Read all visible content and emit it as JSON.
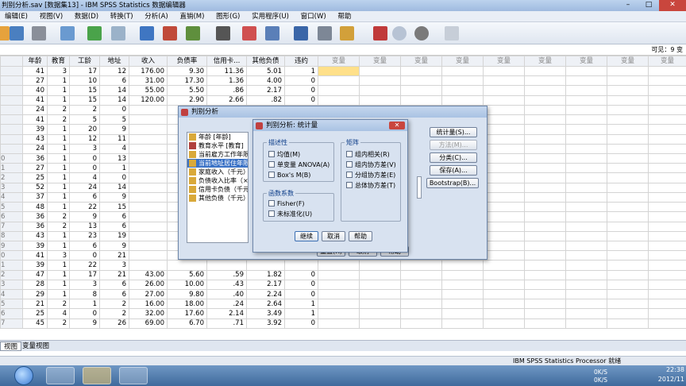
{
  "window": {
    "title": "判别分析.sav [数据集13] - IBM SPSS Statistics 数据编辑器",
    "controls": {
      "minimize": "–",
      "maximize": "□",
      "close": "✕"
    }
  },
  "menu": [
    "编辑(E)",
    "视图(V)",
    "数据(D)",
    "转换(T)",
    "分析(A)",
    "直销(M)",
    "图形(G)",
    "实用程序(U)",
    "窗口(W)",
    "帮助"
  ],
  "visible_vars": "可见：9 变",
  "grid": {
    "columns": [
      "年龄",
      "教育",
      "工龄",
      "地址",
      "收入",
      "负债率",
      "信用卡...",
      "其他负债",
      "违约",
      "变量",
      "变量",
      "变量",
      "变量",
      "变量",
      "变量",
      "变量",
      "变量",
      "变量"
    ],
    "rows": [
      {
        "n": "",
        "cells": [
          "41",
          "3",
          "17",
          "12",
          "176.00",
          "9.30",
          "11.36",
          "5.01",
          "1"
        ]
      },
      {
        "n": "",
        "cells": [
          "27",
          "1",
          "10",
          "6",
          "31.00",
          "17.30",
          "1.36",
          "4.00",
          "0"
        ]
      },
      {
        "n": "",
        "cells": [
          "40",
          "1",
          "15",
          "14",
          "55.00",
          "5.50",
          ".86",
          "2.17",
          "0"
        ]
      },
      {
        "n": "",
        "cells": [
          "41",
          "1",
          "15",
          "14",
          "120.00",
          "2.90",
          "2.66",
          ".82",
          "0"
        ]
      },
      {
        "n": "",
        "cells": [
          "24",
          "2",
          "2",
          "0",
          "",
          "",
          "",
          "",
          ""
        ]
      },
      {
        "n": "",
        "cells": [
          "41",
          "2",
          "5",
          "5",
          "",
          "",
          "",
          "",
          ""
        ]
      },
      {
        "n": "",
        "cells": [
          "39",
          "1",
          "20",
          "9",
          "",
          "",
          "",
          "",
          ""
        ]
      },
      {
        "n": "",
        "cells": [
          "43",
          "1",
          "12",
          "11",
          "",
          "",
          "",
          "",
          ""
        ]
      },
      {
        "n": "",
        "cells": [
          "24",
          "1",
          "3",
          "4",
          "",
          "",
          "",
          "",
          ""
        ]
      },
      {
        "n": "0",
        "cells": [
          "36",
          "1",
          "0",
          "13",
          "",
          "",
          "",
          "",
          ""
        ]
      },
      {
        "n": "1",
        "cells": [
          "27",
          "1",
          "0",
          "1",
          "",
          "",
          "",
          "",
          ""
        ]
      },
      {
        "n": "2",
        "cells": [
          "25",
          "1",
          "4",
          "0",
          "",
          "",
          "",
          "",
          ""
        ]
      },
      {
        "n": "3",
        "cells": [
          "52",
          "1",
          "24",
          "14",
          "",
          "",
          "",
          "",
          ""
        ]
      },
      {
        "n": "4",
        "cells": [
          "37",
          "1",
          "6",
          "9",
          "",
          "",
          "",
          "",
          ""
        ]
      },
      {
        "n": "5",
        "cells": [
          "48",
          "1",
          "22",
          "15",
          "",
          "",
          "",
          "",
          ""
        ]
      },
      {
        "n": "6",
        "cells": [
          "36",
          "2",
          "9",
          "6",
          "",
          "",
          "",
          "",
          ""
        ]
      },
      {
        "n": "7",
        "cells": [
          "36",
          "2",
          "13",
          "6",
          "",
          "",
          "",
          "",
          ""
        ]
      },
      {
        "n": "8",
        "cells": [
          "43",
          "1",
          "23",
          "19",
          "",
          "",
          "",
          "",
          ""
        ]
      },
      {
        "n": "9",
        "cells": [
          "39",
          "1",
          "6",
          "9",
          "",
          "",
          "",
          "",
          ""
        ]
      },
      {
        "n": "0",
        "cells": [
          "41",
          "3",
          "0",
          "21",
          "",
          "",
          "",
          "",
          ""
        ]
      },
      {
        "n": "1",
        "cells": [
          "39",
          "1",
          "22",
          "3",
          "",
          "",
          "",
          "",
          ""
        ]
      },
      {
        "n": "2",
        "cells": [
          "47",
          "1",
          "17",
          "21",
          "43.00",
          "5.60",
          ".59",
          "1.82",
          "0"
        ]
      },
      {
        "n": "3",
        "cells": [
          "28",
          "1",
          "3",
          "6",
          "26.00",
          "10.00",
          ".43",
          "2.17",
          "0"
        ]
      },
      {
        "n": "4",
        "cells": [
          "29",
          "1",
          "8",
          "6",
          "27.00",
          "9.80",
          ".40",
          "2.24",
          "0"
        ]
      },
      {
        "n": "5",
        "cells": [
          "21",
          "2",
          "1",
          "2",
          "16.00",
          "18.00",
          ".24",
          "2.64",
          "1"
        ]
      },
      {
        "n": "6",
        "cells": [
          "25",
          "4",
          "0",
          "2",
          "32.00",
          "17.60",
          "2.14",
          "3.49",
          "1"
        ]
      },
      {
        "n": "7",
        "cells": [
          "45",
          "2",
          "9",
          "26",
          "69.00",
          "6.70",
          ".71",
          "3.92",
          "0"
        ]
      }
    ]
  },
  "tabs": {
    "data_view": "视图",
    "variable_view": "变量视图"
  },
  "status": {
    "processor": "IBM SPSS Statistics Processor 就绪"
  },
  "taskbar": {
    "up_speed": "0K/S",
    "down_speed": "0K/S",
    "time": "22:38",
    "date": "2012/11"
  },
  "main_dialog": {
    "title": "判别分析",
    "variables": [
      "年龄 [年龄]",
      "教育水平 [教育]",
      "当前雇方工作年限",
      "当前地址居住年限",
      "家庭收入（千元）",
      "负债收入比率（×",
      "信用卡负债（千元）",
      "其他负债（千元）"
    ],
    "side_buttons": {
      "stats": "统计量(S)...",
      "method": "方法(M)...",
      "classify": "分类(C)...",
      "save": "保存(A)...",
      "bootstrap": "Bootstrap(B)..."
    },
    "bottom_buttons": {
      "reset": "重置(R)",
      "cancel": "取消",
      "help": "帮助"
    }
  },
  "stats_dialog": {
    "title": "判别分析: 统计量",
    "close": "✕",
    "descriptives_label": "描述性",
    "descriptives": [
      "均值(M)",
      "单变量 ANOVA(A)",
      "Box's M(B)"
    ],
    "coef_label": "函数系数",
    "coefs": [
      "Fisher(F)",
      "未标准化(U)"
    ],
    "matrix_label": "矩阵",
    "matrices": [
      "组内相关(R)",
      "组内协方差(V)",
      "分组协方差(E)",
      "总体协方差(T)"
    ],
    "buttons": {
      "continue": "继续",
      "cancel": "取消",
      "help": "帮助"
    }
  }
}
